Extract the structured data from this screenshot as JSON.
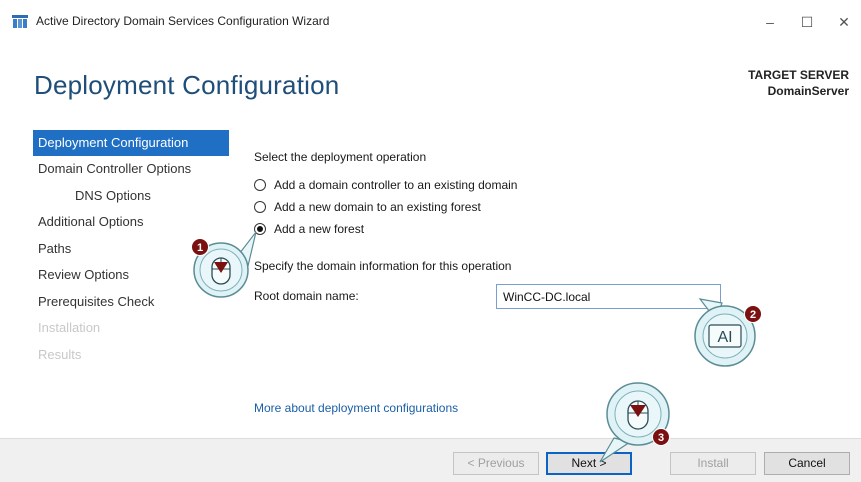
{
  "window": {
    "title": "Active Directory Domain Services Configuration Wizard",
    "controls": {
      "minimize": "–",
      "maximize": "☐",
      "close": "✕"
    }
  },
  "header": {
    "title": "Deployment Configuration",
    "target_label": "TARGET SERVER",
    "target_value": "DomainServer"
  },
  "sidebar": {
    "items": [
      {
        "label": "Deployment Configuration",
        "state": "active"
      },
      {
        "label": "Domain Controller Options",
        "state": "normal"
      },
      {
        "label": "DNS Options",
        "state": "normal"
      },
      {
        "label": "Additional Options",
        "state": "normal"
      },
      {
        "label": "Paths",
        "state": "normal"
      },
      {
        "label": "Review Options",
        "state": "normal"
      },
      {
        "label": "Prerequisites Check",
        "state": "normal"
      },
      {
        "label": "Installation",
        "state": "disabled"
      },
      {
        "label": "Results",
        "state": "disabled"
      }
    ]
  },
  "main": {
    "prompt": "Select the deployment operation",
    "options": [
      {
        "label": "Add a domain controller to an existing domain",
        "selected": false
      },
      {
        "label": "Add a new domain to an existing forest",
        "selected": false
      },
      {
        "label": "Add a new forest",
        "selected": true
      }
    ],
    "specify_text": "Specify the domain information for this operation",
    "root_domain_label": "Root domain name:",
    "root_domain_value": "WinCC-DC.local",
    "more_link": "More about deployment configurations"
  },
  "footer": {
    "previous": "< Previous",
    "next": "Next >",
    "install": "Install",
    "cancel": "Cancel"
  },
  "callouts": {
    "one": "1",
    "two": "2",
    "three": "3",
    "text_cursor_glyph": "AI",
    "color": "#7a1010"
  },
  "colors": {
    "accent": "#1f6fc4",
    "title": "#1e4e79",
    "link": "#1a5fa8"
  }
}
